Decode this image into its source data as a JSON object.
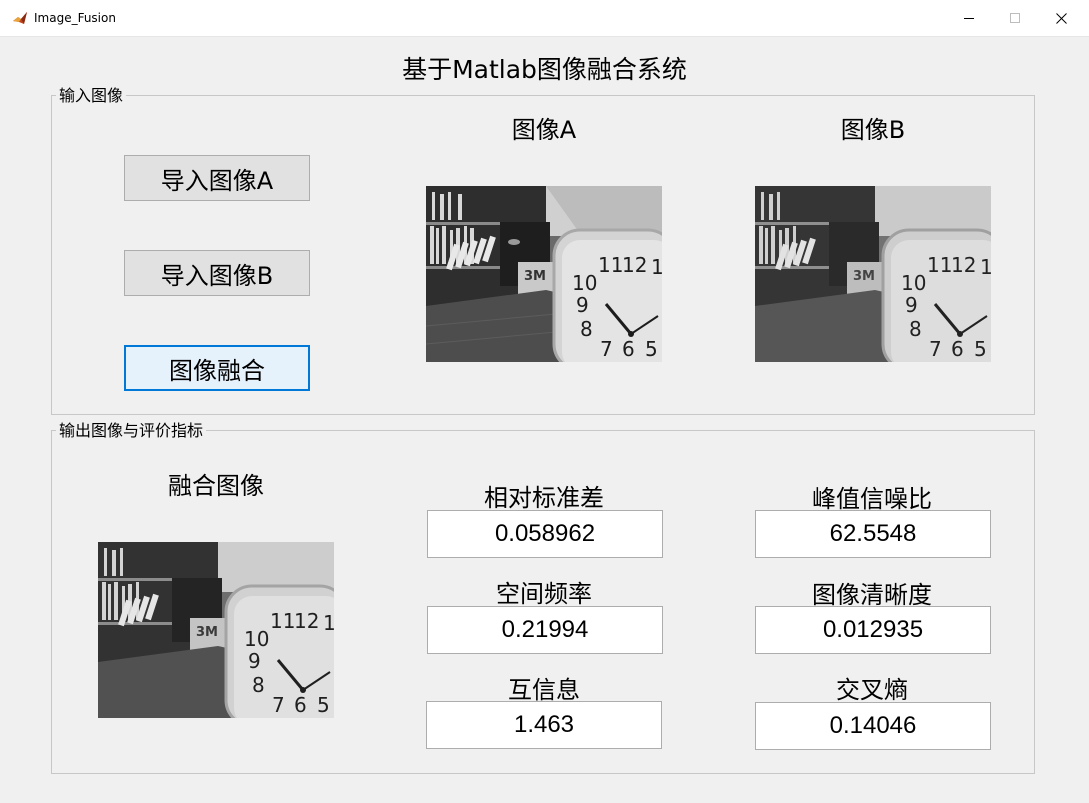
{
  "window": {
    "title": "Image_Fusion",
    "icon": "matlab-icon",
    "controls": [
      "minimize-icon",
      "maximize-icon",
      "close-icon"
    ]
  },
  "main_title": "基于Matlab图像融合系统",
  "input_panel": {
    "title": "输入图像",
    "buttons": {
      "import_a": "导入图像A",
      "import_b": "导入图像B",
      "fuse": "图像融合"
    },
    "image_a_label": "图像A",
    "image_b_label": "图像B",
    "clock_numbers": [
      "11",
      "12",
      "1",
      "10",
      "9",
      "8",
      "7",
      "6",
      "5"
    ],
    "box_brand": "3M"
  },
  "output_panel": {
    "title": "输出图像与评价指标",
    "fused_label": "融合图像",
    "metrics": [
      {
        "label": "相对标准差",
        "value": "0.058962"
      },
      {
        "label": "峰值信噪比",
        "value": "62.5548"
      },
      {
        "label": "空间频率",
        "value": "0.21994"
      },
      {
        "label": "图像清晰度",
        "value": "0.012935"
      },
      {
        "label": "互信息",
        "value": "1.463"
      },
      {
        "label": "交叉熵",
        "value": "0.14046"
      }
    ]
  },
  "colors": {
    "window_bg": "#f0f0f0",
    "button_bg": "#e1e1e1",
    "focus_blue": "#0078d7",
    "panel_border": "#c7c7c7"
  }
}
